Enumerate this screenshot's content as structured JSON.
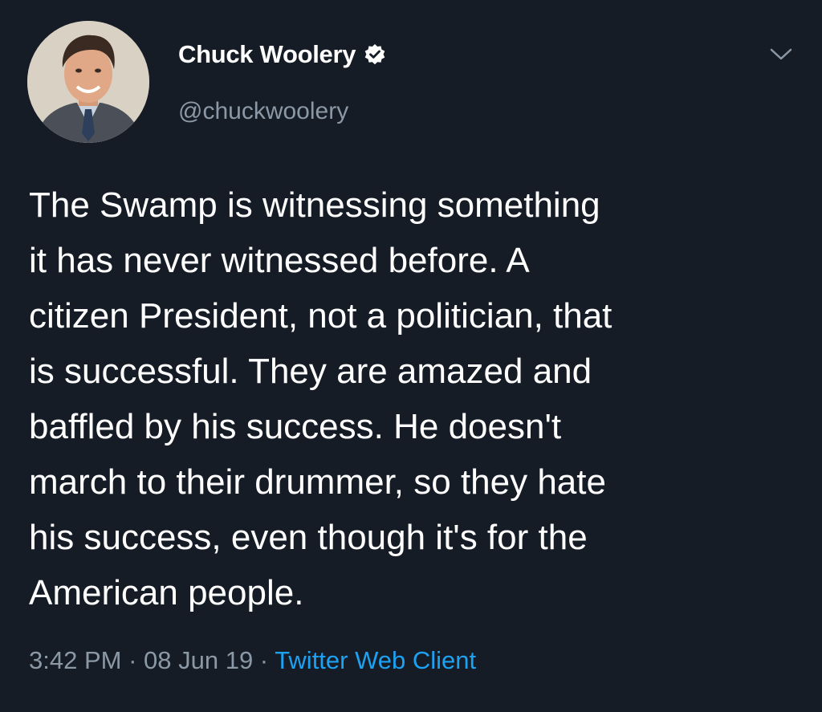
{
  "colors": {
    "background": "#151c26",
    "text": "#ffffff",
    "muted": "#8b98a5",
    "link": "#1da1f2"
  },
  "header": {
    "avatar_icon": "profile-photo",
    "display_name": "Chuck Woolery",
    "verified_icon": "verified-badge-icon",
    "handle": "@chuckwoolery",
    "menu_icon": "chevron-down-icon"
  },
  "tweet": {
    "lines": [
      "The Swamp is witnessing something",
      "it has never witnessed before. A",
      "citizen President, not a politician, that",
      "is successful. They are amazed and",
      "baffled by his success. He doesn't",
      "march to their drummer, so they hate",
      "his success, even though it's for the",
      "American people."
    ]
  },
  "meta": {
    "time": "3:42 PM",
    "sep1": " · ",
    "date": "08 Jun 19",
    "sep2": " · ",
    "source": "Twitter Web Client"
  }
}
